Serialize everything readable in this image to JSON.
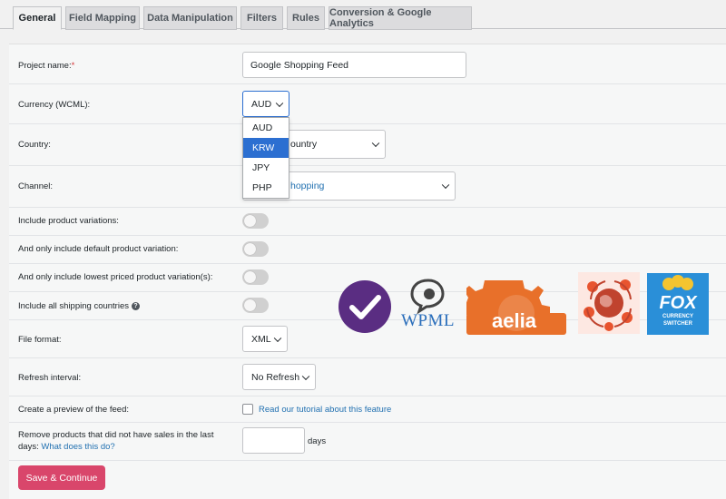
{
  "tabs": [
    {
      "label": "General"
    },
    {
      "label": "Field Mapping"
    },
    {
      "label": "Data Manipulation"
    },
    {
      "label": "Filters"
    },
    {
      "label": "Rules"
    },
    {
      "label": "Conversion & Google Analytics"
    }
  ],
  "form": {
    "project_name": {
      "label": "Project name:",
      "required_mark": "*",
      "value": "Google Shopping Feed"
    },
    "currency": {
      "label": "Currency (WCML):",
      "value": "AUD",
      "options": [
        "AUD",
        "KRW",
        "JPY",
        "PHP"
      ],
      "highlighted": "KRW"
    },
    "country": {
      "label": "Country:",
      "value_visible": "ountry"
    },
    "channel": {
      "label": "Channel:",
      "value_visible": "hopping"
    },
    "include_variations": {
      "label": "Include product variations:"
    },
    "default_variation": {
      "label": "And only include default product variation:"
    },
    "lowest_variation": {
      "label": "And only include lowest priced product variation(s):"
    },
    "shipping_countries": {
      "label": "Include all shipping countries",
      "help_icon": "?"
    },
    "file_format": {
      "label": "File format:",
      "value": "XML"
    },
    "refresh_interval": {
      "label": "Refresh interval:",
      "value": "No Refresh"
    },
    "preview": {
      "label": "Create a preview of the feed:",
      "link": "Read our tutorial about this feature"
    },
    "remove_products": {
      "label": "Remove products that did not have sales in the last days:",
      "link": "What does this do?",
      "unit": "days"
    },
    "submit": {
      "label": "Save & Continue"
    }
  },
  "logos": {
    "wpml_text": "WPML",
    "aelia_text": "aelia",
    "fox_text": "FOX",
    "fox_sub1": "CURRENCY",
    "fox_sub2": "SWITCHER"
  },
  "colors": {
    "accent": "#d9466b",
    "link": "#2271b1",
    "highlight": "#2c6fd1",
    "woo_purple": "#5a2d82",
    "aelia_orange": "#e8702a",
    "fox_blue": "#2a8fd8"
  }
}
